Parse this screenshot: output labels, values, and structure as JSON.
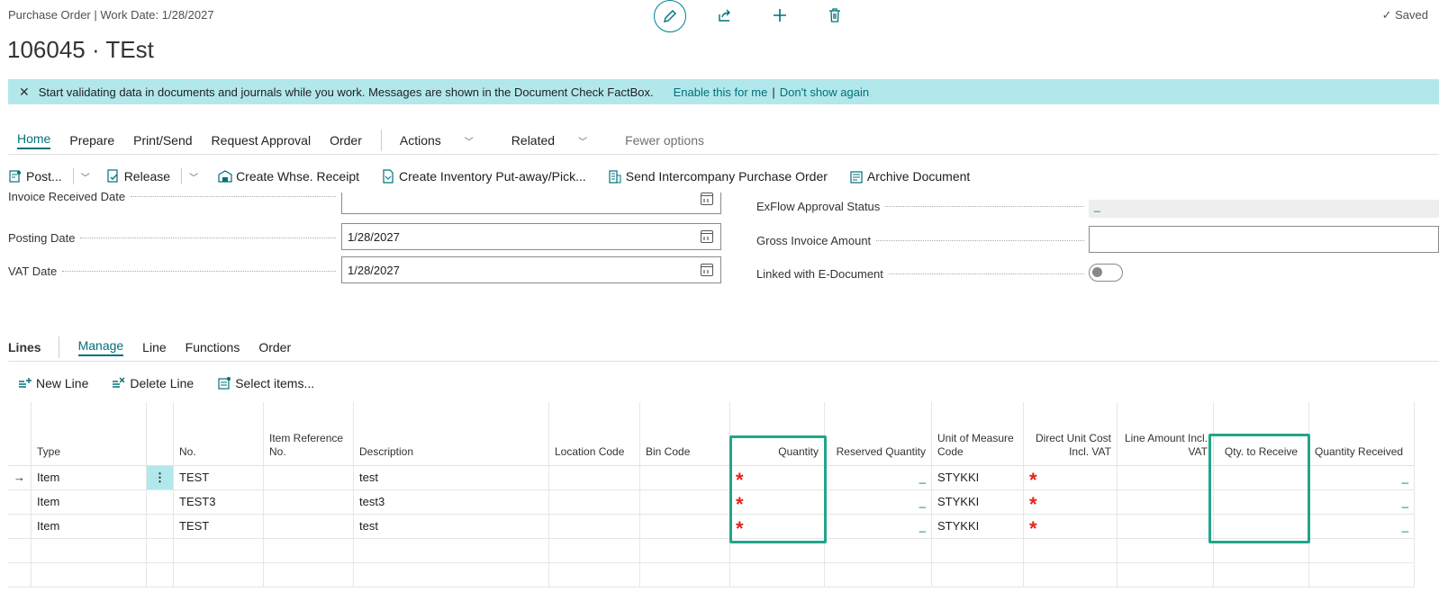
{
  "header": {
    "caption": "Purchase Order | Work Date: 1/28/2027",
    "title": "106045 · TEst",
    "saved": "Saved",
    "icons": [
      "pencil-icon",
      "share-icon",
      "plus-icon",
      "trash-icon"
    ]
  },
  "banner": {
    "message": "Start validating data in documents and journals while you work. Messages are shown in the Document Check FactBox.",
    "enable": "Enable this for me",
    "sep": "|",
    "dismiss": "Don't show again"
  },
  "nav": {
    "tabs": [
      "Home",
      "Prepare",
      "Print/Send",
      "Request Approval",
      "Order"
    ],
    "actions": "Actions",
    "related": "Related",
    "fewer": "Fewer options"
  },
  "actions": {
    "post": "Post...",
    "release": "Release",
    "whse": "Create Whse. Receipt",
    "putaway": "Create Inventory Put-away/Pick...",
    "intercompany": "Send Intercompany Purchase Order",
    "archive": "Archive Document"
  },
  "fields": {
    "invoice_received_label": "Invoice Received Date",
    "posting_label": "Posting Date",
    "posting_value": "1/28/2027",
    "vat_label": "VAT Date",
    "vat_value": "1/28/2027",
    "exflow_label": "ExFlow Approval Status",
    "exflow_value": "_",
    "gross_label": "Gross Invoice Amount",
    "gross_value": "",
    "linked_label": "Linked with E-Document"
  },
  "lines": {
    "title": "Lines",
    "tabs": [
      "Manage",
      "Line",
      "Functions",
      "Order"
    ],
    "new_line": "New Line",
    "delete_line": "Delete Line",
    "select_items": "Select items...",
    "columns": {
      "type": "Type",
      "no": "No.",
      "item_ref": "Item Reference No.",
      "description": "Description",
      "location": "Location Code",
      "bin": "Bin Code",
      "quantity": "Quantity",
      "reserved": "Reserved Quantity",
      "uom": "Unit of Measure Code",
      "direct_cost": "Direct Unit Cost Incl. VAT",
      "line_amount": "Line Amount Incl. VAT",
      "qty_receive": "Qty. to Receive",
      "qty_received": "Quantity Received"
    },
    "rows": [
      {
        "type": "Item",
        "no": "TEST",
        "description": "test",
        "reserved": "_",
        "uom": "STYKKI",
        "received": "_"
      },
      {
        "type": "Item",
        "no": "TEST3",
        "description": "test3",
        "reserved": "_",
        "uom": "STYKKI",
        "received": "_"
      },
      {
        "type": "Item",
        "no": "TEST",
        "description": "test",
        "reserved": "_",
        "uom": "STYKKI",
        "received": "_"
      }
    ],
    "required_mark": "*",
    "row_menu": "⋮",
    "current_row_arrow": "→"
  },
  "colors": {
    "accent": "#00707a",
    "banner": "#b2e8ec",
    "highlight": "#22a58a",
    "required": "#e3241b"
  }
}
